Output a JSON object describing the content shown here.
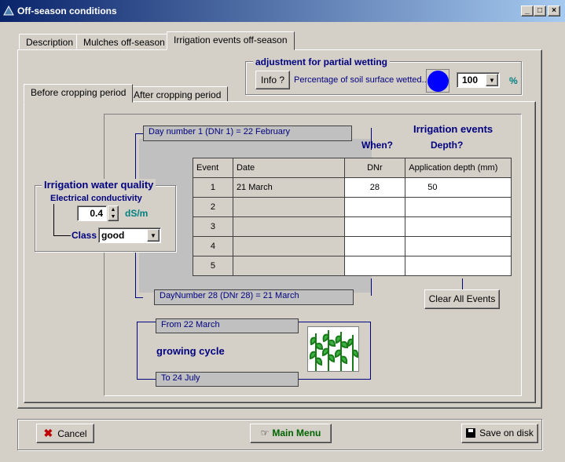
{
  "window": {
    "title": "Off-season conditions"
  },
  "tabs": [
    {
      "label": "Description"
    },
    {
      "label": "Mulches off-season"
    },
    {
      "label": "Irrigation events off-season"
    }
  ],
  "partial_wetting": {
    "title": "adjustment for partial wetting",
    "info_label": "Info ?",
    "text": "Percentage of soil surface wetted...",
    "value": "100",
    "unit": "%"
  },
  "subtabs": [
    {
      "label": "Before cropping period"
    },
    {
      "label": "After cropping period"
    }
  ],
  "water_quality": {
    "title": "Irrigation water quality",
    "ec_label": "Electrical conductivity",
    "ec_value": "0.4",
    "ec_unit": "dS/m",
    "class_label": "Class",
    "class_value": "good"
  },
  "schedule": {
    "day1_label": "Day number 1 (DNr 1) = 22 February",
    "heading": "Irrigation events",
    "when": "When?",
    "depth": "Depth?",
    "columns": [
      "Event",
      "Date",
      "DNr",
      "Application depth (mm)"
    ],
    "rows": [
      {
        "event": "1",
        "date": "21 March",
        "dnr": "28",
        "depth": "50"
      },
      {
        "event": "2",
        "date": "",
        "dnr": "",
        "depth": ""
      },
      {
        "event": "3",
        "date": "",
        "dnr": "",
        "depth": ""
      },
      {
        "event": "4",
        "date": "",
        "dnr": "",
        "depth": ""
      },
      {
        "event": "5",
        "date": "",
        "dnr": "",
        "depth": ""
      }
    ],
    "dayend_label": "DayNumber 28 (DNr 28) = 21 March",
    "clear_label": "Clear All Events"
  },
  "cycle": {
    "from_label": "From 22 March",
    "title": "growing cycle",
    "to_label": "To  24 July"
  },
  "footer": {
    "cancel": "Cancel",
    "main_menu": "Main Menu",
    "save": "Save on disk"
  },
  "colors": {
    "accent": "#00007f",
    "teal": "#007f7f",
    "wetted_circle": "#0000ff"
  }
}
